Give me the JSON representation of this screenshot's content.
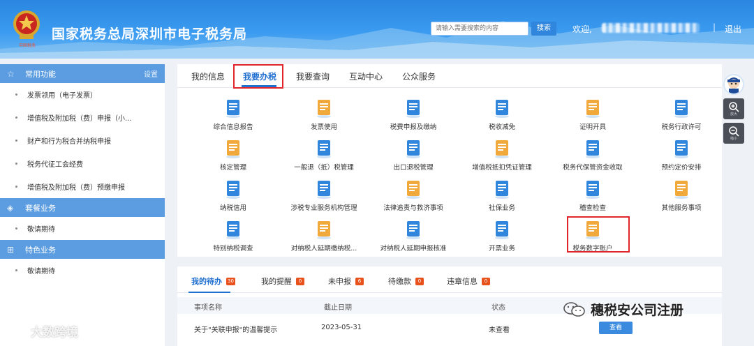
{
  "header": {
    "title": "国家税务总局深圳市电子税务局",
    "emblem_caption": "中国税务",
    "search_placeholder": "请输入需要搜索的内容",
    "search_button": "搜索",
    "welcome": "欢迎,",
    "separator": "|",
    "logout": "退出"
  },
  "sidebar": {
    "sections": [
      {
        "title": "常用功能",
        "icon": "star-icon",
        "action": "设置",
        "items": [
          "发票领用（电子发票）",
          "增值税及附加税（费）申报（小...",
          "财产和行为税合并纳税申报",
          "税务代征工会经费",
          "增值税及附加税（费）预缴申报"
        ]
      },
      {
        "title": "套餐业务",
        "icon": "layers-icon",
        "items": [
          "敬请期待"
        ]
      },
      {
        "title": "特色业务",
        "icon": "apps-icon",
        "items": [
          "敬请期待"
        ]
      }
    ]
  },
  "main": {
    "tabs": [
      "我的信息",
      "我要办税",
      "我要查询",
      "互动中心",
      "公众服务"
    ],
    "active_tab": "我要办税",
    "functions": [
      [
        "综合信息报告",
        "发票使用",
        "税费申报及缴纳",
        "税收减免",
        "证明开具",
        "税务行政许可"
      ],
      [
        "核定管理",
        "一般退（抵）税管理",
        "出口退税管理",
        "增值税抵扣凭证管理",
        "税务代保管资金收取",
        "预约定价安排"
      ],
      [
        "纳税信用",
        "涉税专业服务机构管理",
        "法律追责与救济事项",
        "社保业务",
        "稽查检查",
        "其他服务事项"
      ],
      [
        "特别纳税调查",
        "对纳税人延期缴纳税...",
        "对纳税人延期申报核准",
        "开票业务",
        "税务数字账户"
      ]
    ],
    "icons": [
      [
        "report-icon",
        "yuan-ticket-icon",
        "hand-coin-icon",
        "tax-relief-icon",
        "certificate-icon",
        "license-icon"
      ],
      [
        "user-check-icon",
        "refund-icon",
        "export-refund-icon",
        "voucher-icon",
        "vault-icon",
        "calendar-icon"
      ],
      [
        "credit-badge-icon",
        "agency-icon",
        "gavel-icon",
        "social-security-icon",
        "shield-check-icon",
        "heart-hand-icon"
      ],
      [
        "investigation-icon",
        "delay-payment-icon",
        "delay-declare-icon",
        "invoice-yuan-icon",
        "digital-account-icon"
      ]
    ],
    "highlighted_function": "税务数字账户"
  },
  "float_tools": {
    "zoom_in": "放大",
    "zoom_out": "缩小"
  },
  "todo": {
    "tabs": [
      {
        "label": "我的待办",
        "count": "30"
      },
      {
        "label": "我的提醒",
        "count": "0"
      },
      {
        "label": "未申报",
        "count": "6"
      },
      {
        "label": "待缴款",
        "count": "0"
      },
      {
        "label": "违章信息",
        "count": "0"
      }
    ],
    "columns": [
      "事项名称",
      "截止日期",
      "状态"
    ],
    "rows": [
      {
        "name": "关于\"关联申报\"的温馨提示",
        "date": "2023-05-31",
        "status": "未查看",
        "action": "查看"
      }
    ]
  },
  "watermarks": {
    "left": "大数跨境",
    "right": "穗税安公司注册"
  },
  "colors": {
    "brand_blue": "#1f6fd0",
    "header_blue": "#3b9bf0",
    "sidebar_head": "#5b9de0",
    "highlight_red": "#e0262a",
    "badge_orange": "#e8501c"
  }
}
